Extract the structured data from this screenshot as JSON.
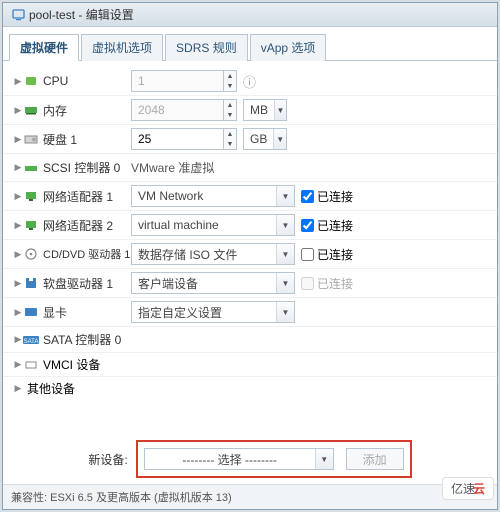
{
  "title": "pool-test - 编辑设置",
  "tabs": [
    "虚拟硬件",
    "虚拟机选项",
    "SDRS 规则",
    "vApp 选项"
  ],
  "rows": {
    "cpu": {
      "label": "CPU",
      "value": "1"
    },
    "memory": {
      "label": "内存",
      "value": "2048",
      "unit": "MB"
    },
    "disk": {
      "label": "硬盘 1",
      "value": "25",
      "unit": "GB"
    },
    "scsi": {
      "label": "SCSI 控制器 0",
      "value": "VMware 准虚拟"
    },
    "net1": {
      "label": "网络适配器 1",
      "value": "VM Network",
      "connected_label": "已连接",
      "connected": true
    },
    "net2": {
      "label": "网络适配器 2",
      "value": "virtual machine",
      "connected_label": "已连接",
      "connected": true
    },
    "cd": {
      "label": "CD/DVD 驱动器 1",
      "value": "数据存储 ISO 文件",
      "connected_label": "已连接",
      "connected": false
    },
    "floppy": {
      "label": "软盘驱动器 1",
      "value": "客户端设备",
      "connected_label": "已连接",
      "disabled": true
    },
    "video": {
      "label": "显卡",
      "value": "指定自定义设置"
    },
    "sata": {
      "label": "SATA 控制器 0"
    },
    "vmci": {
      "label": "VMCI 设备"
    },
    "other": {
      "label": "其他设备"
    }
  },
  "footer": {
    "new_device_label": "新设备:",
    "new_device_value": "-------- 选择 --------",
    "add_label": "添加"
  },
  "compat": "兼容性: ESXi 6.5 及更高版本 (虚拟机版本 13)",
  "watermark": {
    "a": "亿速",
    "b": "云"
  }
}
